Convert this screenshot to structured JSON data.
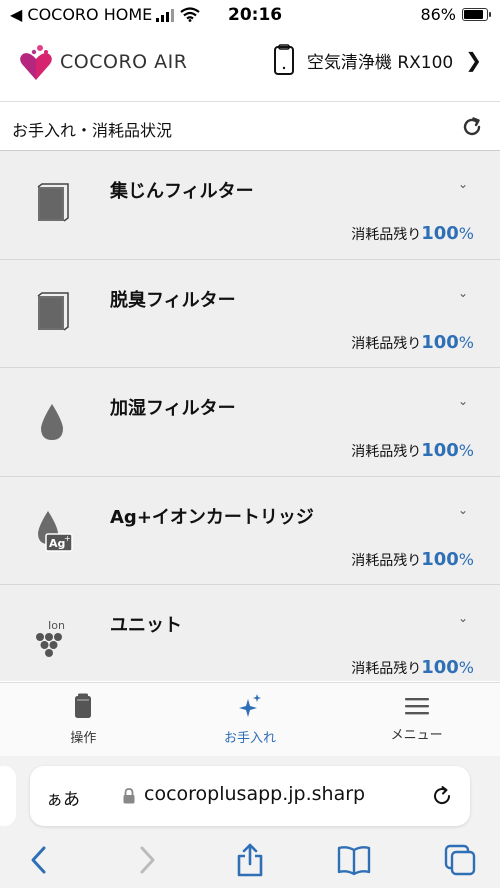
{
  "status_bar": {
    "back_label": "◀ COCORO HOME",
    "time": "20:16",
    "battery": "86%",
    "battery_level": 0.86
  },
  "header": {
    "logo_text": "COCORO AIR",
    "device_name": "空気清浄機 RX100"
  },
  "section": {
    "title": "お手入れ・消耗品状況"
  },
  "items": [
    {
      "name": "集じんフィルター",
      "remain_label": "消耗品残り",
      "remain_value": "100",
      "unit": "%",
      "icon": "filter-icon"
    },
    {
      "name": "脱臭フィルター",
      "remain_label": "消耗品残り",
      "remain_value": "100",
      "unit": "%",
      "icon": "filter-icon"
    },
    {
      "name": "加湿フィルター",
      "remain_label": "消耗品残り",
      "remain_value": "100",
      "unit": "%",
      "icon": "water-drop-icon"
    },
    {
      "name": "Ag+イオンカートリッジ",
      "remain_label": "消耗品残り",
      "remain_value": "100",
      "unit": "%",
      "icon": "ag-ion-drop-icon"
    },
    {
      "name": "ユニット",
      "remain_label": "消耗品残り",
      "remain_value": "100",
      "unit": "%",
      "icon": "ion-unit-icon"
    }
  ],
  "tabs": [
    {
      "label": "操作",
      "icon": "purifier-icon",
      "active": false
    },
    {
      "label": "お手入れ",
      "icon": "sparkle-icon",
      "active": true
    },
    {
      "label": "メニュー",
      "icon": "hamburger-icon",
      "active": false
    }
  ],
  "browser": {
    "text_size_label": "ぁあ",
    "url": "cocoroplusapp.jp.sharp"
  },
  "colors": {
    "accent": "#2e6fb6",
    "logo_pink": "#d6246e",
    "logo_purple": "#9b2a8c"
  }
}
